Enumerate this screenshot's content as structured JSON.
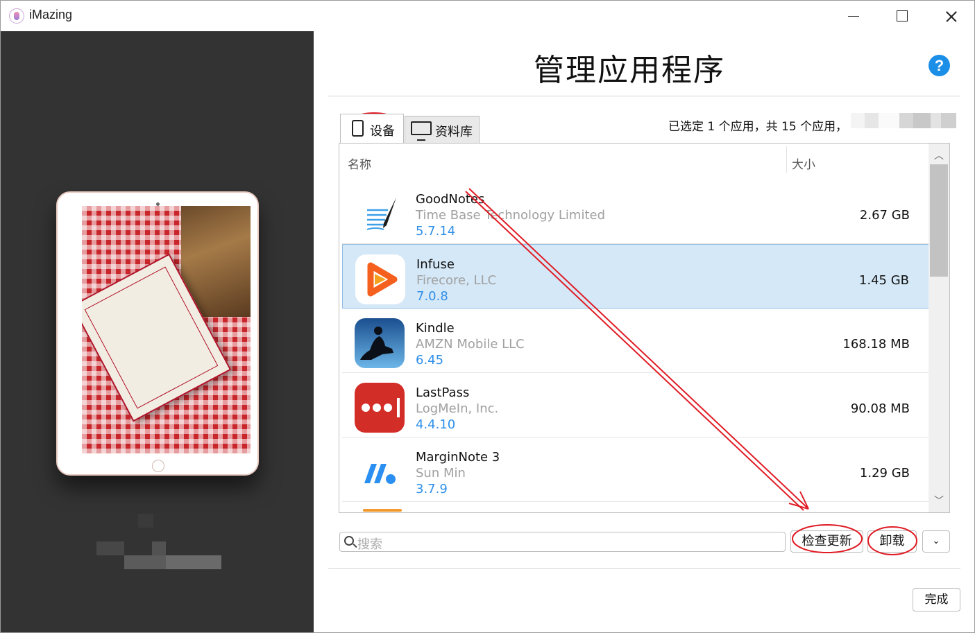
{
  "window": {
    "title": "iMazing",
    "controls": [
      "minimize",
      "maximize",
      "close"
    ]
  },
  "page": {
    "title": "管理应用程序",
    "help_symbol": "?"
  },
  "tabs": [
    {
      "label": "设备",
      "icon": "tablet-icon",
      "active": true
    },
    {
      "label": "资料库",
      "icon": "monitor-icon",
      "active": false
    }
  ],
  "summary": "已选定 1 个应用，共 15 个应用，",
  "table": {
    "columns": [
      "名称",
      "大小"
    ],
    "rows": [
      {
        "name": "GoodNotes",
        "vendor": "Time Base Technology Limited",
        "version": "5.7.14",
        "size": "2.67 GB",
        "icon": "goodnotes-icon",
        "selected": false
      },
      {
        "name": "Infuse",
        "vendor": "Firecore, LLC",
        "version": "7.0.8",
        "size": "1.45 GB",
        "icon": "infuse-icon",
        "selected": true
      },
      {
        "name": "Kindle",
        "vendor": "AMZN Mobile LLC",
        "version": "6.45",
        "size": "168.18 MB",
        "icon": "kindle-icon",
        "selected": false
      },
      {
        "name": "LastPass",
        "vendor": "LogMeIn, Inc.",
        "version": "4.4.10",
        "size": "90.08 MB",
        "icon": "lastpass-icon",
        "selected": false
      },
      {
        "name": "MarginNote 3",
        "vendor": "Sun Min",
        "version": "3.7.9",
        "size": "1.29 GB",
        "icon": "marginnote-icon",
        "selected": false
      }
    ]
  },
  "toolbar": {
    "search_placeholder": "搜索",
    "check_updates_label": "检查更新",
    "uninstall_label": "卸载",
    "more_symbol": "⌄",
    "done_label": "完成"
  },
  "colors": {
    "accent": "#2f8fe8",
    "selection": "#d5e8f7",
    "left_panel": "#333333",
    "annotation": "#e01b24"
  }
}
